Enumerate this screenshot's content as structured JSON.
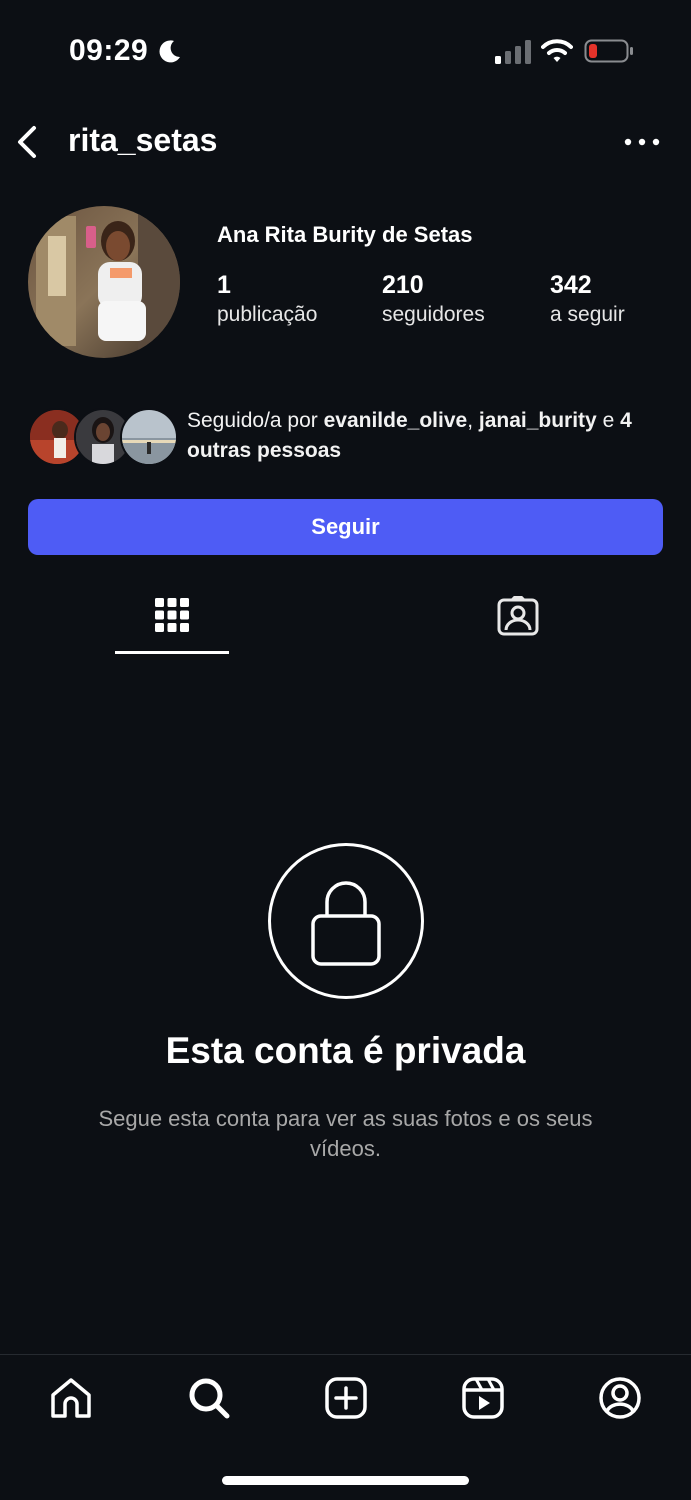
{
  "status_bar": {
    "time": "09:29",
    "icons": [
      "moon-icon",
      "cellular-signal-icon",
      "wifi-icon",
      "battery-low-icon"
    ],
    "battery_color": "#e5332a"
  },
  "header": {
    "username": "rita_setas",
    "back_icon": "chevron-left-icon",
    "more_icon": "more-horizontal-icon"
  },
  "profile": {
    "full_name": "Ana Rita Burity de Setas",
    "stats": [
      {
        "value": "1",
        "label": "publicação"
      },
      {
        "value": "210",
        "label": "seguidores"
      },
      {
        "value": "342",
        "label": "a seguir"
      }
    ]
  },
  "followed_by": {
    "prefix": "Seguido/a por ",
    "user1": "evanilde_olive",
    "separator": ", ",
    "user2": "janai_burity",
    "conj": " e ",
    "others": "4 outras pessoas"
  },
  "follow_button": {
    "label": "Seguir",
    "color": "#4e5cf5"
  },
  "tabs": [
    {
      "icon": "grid-icon",
      "active": true
    },
    {
      "icon": "tagged-person-icon",
      "active": false
    }
  ],
  "private_notice": {
    "icon": "lock-icon",
    "title": "Esta conta é privada",
    "subtitle": "Segue esta conta para ver as suas fotos e os seus vídeos."
  },
  "bottom_nav": {
    "items": [
      "home-icon",
      "search-icon",
      "create-icon",
      "reels-icon",
      "profile-icon"
    ]
  }
}
